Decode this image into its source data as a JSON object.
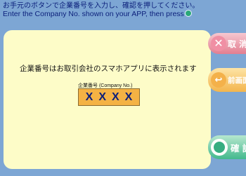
{
  "instructions": {
    "line1": "お手元のボタンで企業番号を入力し、確認を押してください。",
    "line2": "Enter the Company No. shown on your APP, then press"
  },
  "panel": {
    "message": "企業番号はお取引会社のスマホアプリに表示されます",
    "field_label": "企業番号 (Company No.)",
    "field_value": "XXXX"
  },
  "buttons": {
    "cancel": "取 消",
    "previous": "前画面へ",
    "confirm": "確 認"
  },
  "colors": {
    "background": "#7da6d4",
    "panel": "#fdfcc8",
    "field": "#f4b244",
    "text_blue": "#0b1f7a",
    "cancel": "#e27e91",
    "previous": "#f3b54d",
    "confirm": "#43b98d"
  },
  "icons": {
    "cancel": "x-icon",
    "previous": "back-arrow-icon",
    "confirm": "circle-icon"
  }
}
